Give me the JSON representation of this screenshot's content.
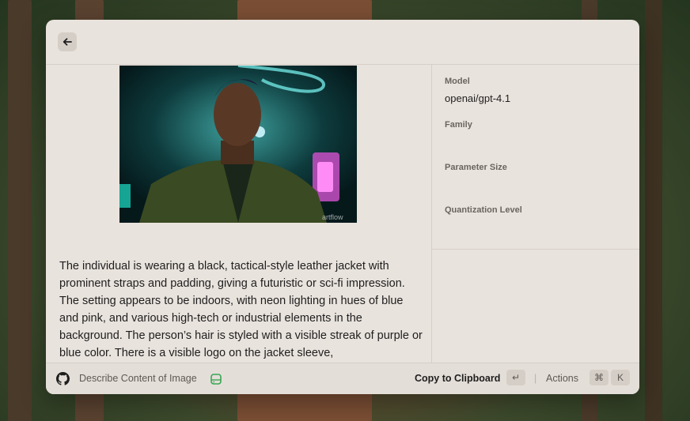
{
  "window": {
    "back_icon": "arrow-left-icon"
  },
  "image": {
    "watermark": "artflow"
  },
  "description": "The individual is wearing a black, tactical-style leather jacket with prominent straps and padding, giving a futuristic or sci-fi impression. The setting appears to be indoors, with neon lighting in hues of blue and pink, and various high-tech or industrial elements in the background. The person’s hair is styled with a visible streak of purple or blue color. There is a visible logo on the jacket sleeve,",
  "metadata": {
    "model_label": "Model",
    "model_value": "openai/gpt-4.1",
    "family_label": "Family",
    "family_value": "",
    "parameter_size_label": "Parameter Size",
    "parameter_size_value": "",
    "quantization_label": "Quantization Level",
    "quantization_value": ""
  },
  "footer": {
    "github_icon": "github-icon",
    "command_title": "Describe Content of Image",
    "extension_icon": "drive-icon",
    "primary_action": "Copy to Clipboard",
    "primary_key": "↵",
    "separator": "|",
    "actions_label": "Actions",
    "actions_key_1": "⌘",
    "actions_key_2": "K"
  },
  "colors": {
    "panel_bg": "#e9e3dd",
    "accent_green": "#3aa655"
  }
}
